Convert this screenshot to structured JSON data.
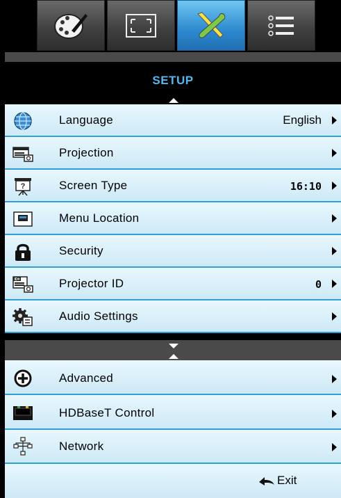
{
  "tabs": [
    {
      "name": "image",
      "icon": "palette-icon",
      "active": false
    },
    {
      "name": "display",
      "icon": "display-expand-icon",
      "active": false
    },
    {
      "name": "setup",
      "icon": "tools-icon",
      "active": true
    },
    {
      "name": "options",
      "icon": "list-options-icon",
      "active": false
    }
  ],
  "title": "SETUP",
  "items": [
    {
      "label": "Language",
      "value": "English",
      "icon": "globe-icon"
    },
    {
      "label": "Projection",
      "value": "",
      "icon": "projection-icon"
    },
    {
      "label": "Screen Type",
      "value": "16:10",
      "icon": "screen-icon"
    },
    {
      "label": "Menu Location",
      "value": "",
      "icon": "menu-location-icon"
    },
    {
      "label": "Security",
      "value": "",
      "icon": "lock-icon"
    },
    {
      "label": "Projector ID",
      "value": "0",
      "icon": "projector-id-icon"
    },
    {
      "label": "Audio Settings",
      "value": "",
      "icon": "audio-settings-icon"
    },
    {
      "label": "Advanced",
      "value": "",
      "icon": "advanced-icon"
    },
    {
      "label": "HDBaseT Control",
      "value": "",
      "icon": "hdbaset-icon"
    },
    {
      "label": "Network",
      "value": "",
      "icon": "network-icon"
    }
  ],
  "exit": {
    "label": "Exit",
    "icon": "exit-arrow-icon"
  },
  "colors": {
    "accent": "#2f9fd8",
    "title": "#55b8f0",
    "row_bg": "#e0f3fb"
  }
}
